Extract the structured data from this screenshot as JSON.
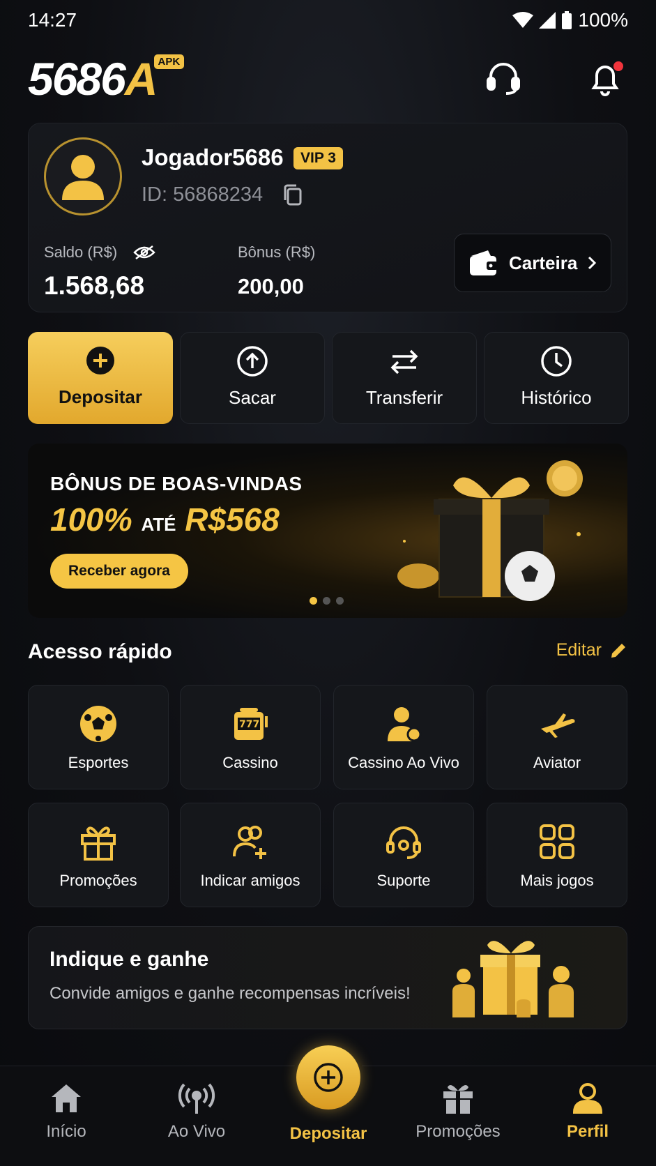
{
  "status_bar": {
    "time": "14:27",
    "battery": "100%"
  },
  "header": {
    "logo_white": "5686",
    "logo_gold": "A",
    "logo_badge": "APK",
    "support_icon": "headset-icon",
    "notification_icon": "bell-icon"
  },
  "profile": {
    "username": "Jogador5686",
    "vip": "VIP 3",
    "id": "ID: 56868234",
    "balance_label": "Saldo (R$)",
    "balance_value": "1.568,68",
    "bonus_label": "Bônus (R$)",
    "bonus_value": "200,00",
    "wallet_label": "Carteira"
  },
  "actions": [
    {
      "label": "Depositar",
      "icon": "plus-circle-icon"
    },
    {
      "label": "Sacar",
      "icon": "arrow-up-circle-icon"
    },
    {
      "label": "Transferir",
      "icon": "transfer-icon"
    },
    {
      "label": "Histórico",
      "icon": "clock-icon"
    }
  ],
  "banner": {
    "title": "BÔNUS DE BOAS-VINDAS",
    "amount_percent": "100%",
    "amount_ate": "ATÉ",
    "amount_value": "R$568",
    "button": "Receber agora",
    "slides": 3,
    "active_slide": 1
  },
  "quick_access": {
    "title": "Acesso rápido",
    "edit": "Editar",
    "items": [
      {
        "label": "Esportes",
        "icon": "soccer-ball-icon"
      },
      {
        "label": "Cassino",
        "icon": "slot-machine-icon"
      },
      {
        "label": "Cassino Ao Vivo",
        "icon": "live-dealer-icon"
      },
      {
        "label": "Aviator",
        "icon": "airplane-icon"
      },
      {
        "label": "Promoções",
        "icon": "gift-icon"
      },
      {
        "label": "Indicar amigos",
        "icon": "add-friend-icon"
      },
      {
        "label": "Suporte",
        "icon": "headset-icon"
      },
      {
        "label": "Mais jogos",
        "icon": "grid-icon"
      }
    ]
  },
  "refer": {
    "title": "Indique e ganhe",
    "subtitle": "Convide amigos e ganhe recompensas incríveis!"
  },
  "bottom_nav": [
    {
      "label": "Início",
      "icon": "home-icon"
    },
    {
      "label": "Ao Vivo",
      "icon": "broadcast-icon"
    },
    {
      "label": "Depositar",
      "icon": "plus-circle-icon"
    },
    {
      "label": "Promoções",
      "icon": "gift-icon"
    },
    {
      "label": "Perfil",
      "icon": "user-icon"
    }
  ],
  "colors": {
    "gold": "#f3c245",
    "background": "#0e0f13",
    "card": "#15171b",
    "notification": "#f0343c"
  }
}
